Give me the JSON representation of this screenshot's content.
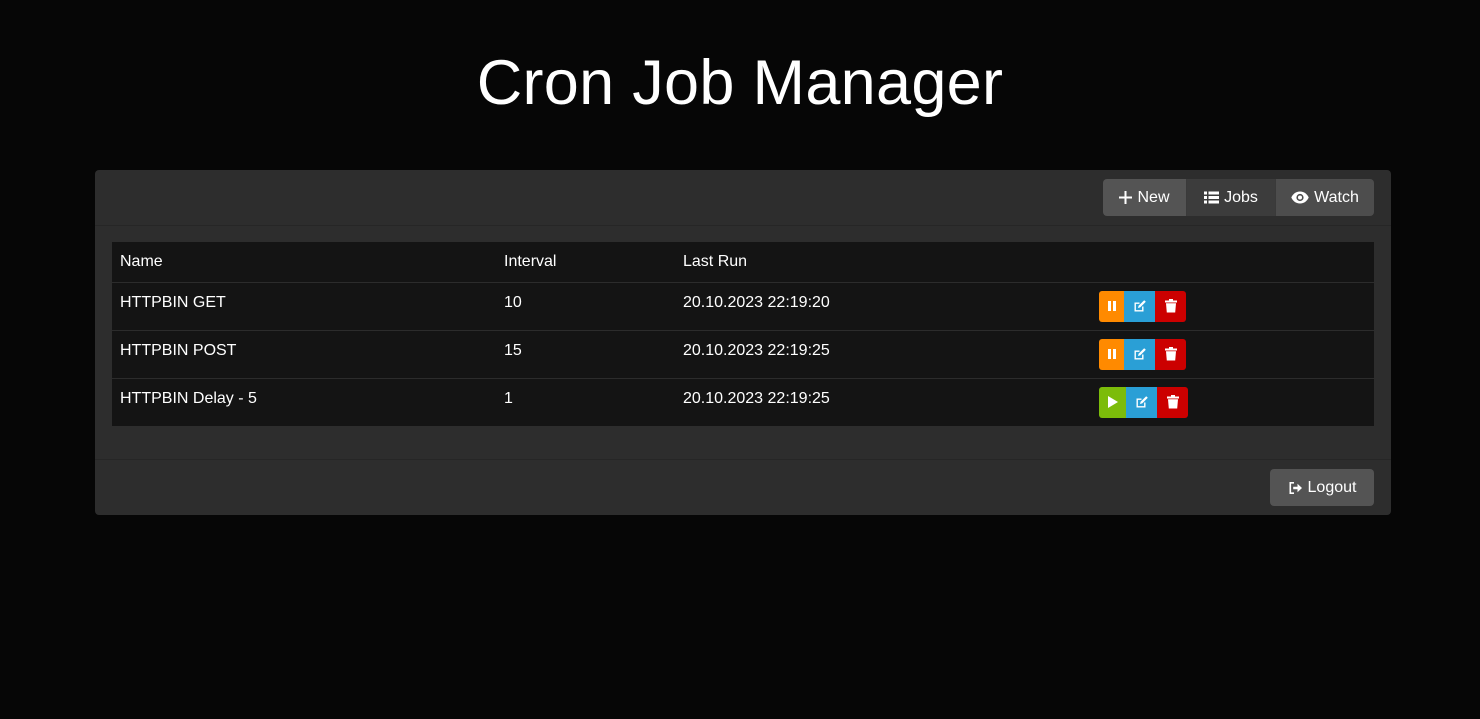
{
  "header": {
    "title": "Cron Job Manager"
  },
  "toolbar": {
    "new_label": "New",
    "jobs_label": "Jobs",
    "watch_label": "Watch"
  },
  "table": {
    "columns": [
      "Name",
      "Interval",
      "Last Run"
    ],
    "rows": [
      {
        "name": "HTTPBIN GET",
        "interval": "10",
        "last_run": "20.10.2023 22:19:20",
        "state": "running"
      },
      {
        "name": "HTTPBIN POST",
        "interval": "15",
        "last_run": "20.10.2023 22:19:25",
        "state": "running"
      },
      {
        "name": "HTTPBIN Delay - 5",
        "interval": "1",
        "last_run": "20.10.2023 22:19:25",
        "state": "paused"
      }
    ]
  },
  "footer": {
    "logout_label": "Logout"
  },
  "colors": {
    "pause": "#ff8a00",
    "play": "#7cbc0a",
    "edit": "#2a9fd6",
    "delete": "#cc0000"
  },
  "icons": {
    "new": "plus-icon",
    "jobs": "list-icon",
    "watch": "eye-icon",
    "logout": "sign-out-icon",
    "pause": "pause-icon",
    "play": "play-icon",
    "edit": "edit-icon",
    "delete": "trash-icon"
  }
}
